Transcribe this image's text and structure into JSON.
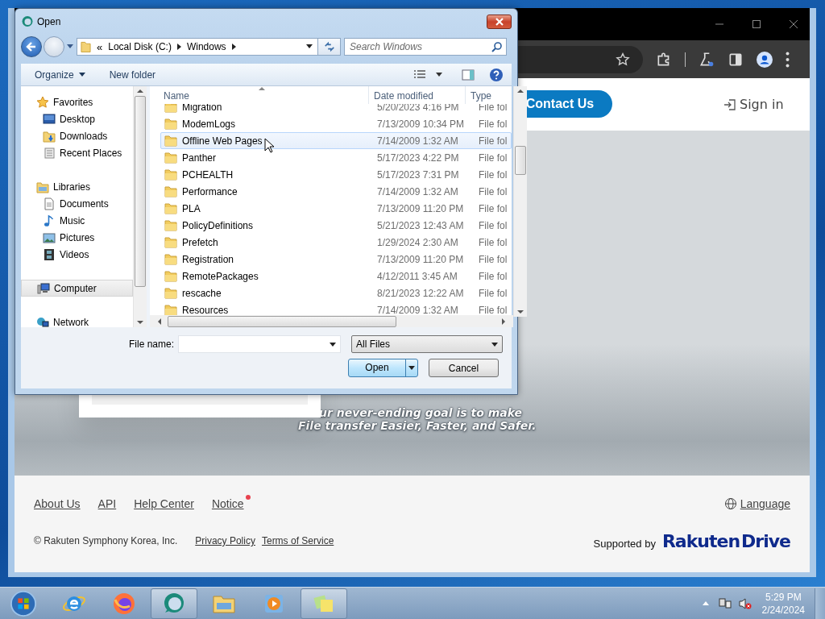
{
  "browser": {
    "header": {
      "contact_button": "Contact Us",
      "sign_in": "Sign in"
    },
    "hero": {
      "tagline": [
        "ur never-ending goal is to make",
        "File transfer Easier, Faster, and Safer."
      ]
    },
    "footer": {
      "links": [
        {
          "label": "About Us",
          "badge": false
        },
        {
          "label": "API",
          "badge": false
        },
        {
          "label": "Help Center",
          "badge": false
        },
        {
          "label": "Notice",
          "badge": true
        }
      ],
      "language": "Language",
      "copyright": "© Rakuten Symphony Korea, Inc.",
      "legal_links": [
        "Privacy Policy",
        "Terms of Service"
      ],
      "supported_by": "Supported by",
      "brand": "Rakuten",
      "brand_product": "Drive"
    }
  },
  "dialog": {
    "title": "Open",
    "breadcrumb_overflow": "«",
    "breadcrumb": [
      "Local Disk (C:)",
      "Windows"
    ],
    "search": {
      "placeholder": "Search Windows"
    },
    "toolbar": {
      "organize": "Organize",
      "new_folder": "New folder"
    },
    "nav": [
      {
        "label": "Favorites",
        "kind": "favorites",
        "selected": false,
        "children": [
          {
            "label": "Desktop",
            "kind": "desktop",
            "selected": false
          },
          {
            "label": "Downloads",
            "kind": "downloads",
            "selected": false
          },
          {
            "label": "Recent Places",
            "kind": "recent",
            "selected": false
          }
        ]
      },
      {
        "label": "Libraries",
        "kind": "libraries",
        "selected": false,
        "children": [
          {
            "label": "Documents",
            "kind": "documents",
            "selected": false
          },
          {
            "label": "Music",
            "kind": "music",
            "selected": false
          },
          {
            "label": "Pictures",
            "kind": "pictures",
            "selected": false
          },
          {
            "label": "Videos",
            "kind": "videos",
            "selected": false
          }
        ]
      },
      {
        "label": "Computer",
        "kind": "computer",
        "selected": true
      },
      {
        "label": "Network",
        "kind": "network",
        "selected": false
      }
    ],
    "columns": [
      "Name",
      "Date modified",
      "Type"
    ],
    "rows": [
      {
        "name": "Migration",
        "date": "5/20/2023 4:16 PM",
        "type": "File fol",
        "hovered": false
      },
      {
        "name": "ModemLogs",
        "date": "7/13/2009 10:34 PM",
        "type": "File fol",
        "hovered": false
      },
      {
        "name": "Offline Web Pages",
        "date": "7/14/2009 1:32 AM",
        "type": "File fol",
        "hovered": true
      },
      {
        "name": "Panther",
        "date": "5/17/2023 4:22 PM",
        "type": "File fol",
        "hovered": false
      },
      {
        "name": "PCHEALTH",
        "date": "5/17/2023 7:31 PM",
        "type": "File fol",
        "hovered": false
      },
      {
        "name": "Performance",
        "date": "7/14/2009 1:32 AM",
        "type": "File fol",
        "hovered": false
      },
      {
        "name": "PLA",
        "date": "7/13/2009 11:20 PM",
        "type": "File fol",
        "hovered": false
      },
      {
        "name": "PolicyDefinitions",
        "date": "5/21/2023 12:43 AM",
        "type": "File fol",
        "hovered": false
      },
      {
        "name": "Prefetch",
        "date": "1/29/2024 2:30 AM",
        "type": "File fol",
        "hovered": false
      },
      {
        "name": "Registration",
        "date": "7/13/2009 11:20 PM",
        "type": "File fol",
        "hovered": false
      },
      {
        "name": "RemotePackages",
        "date": "4/12/2011 3:45 AM",
        "type": "File fol",
        "hovered": false
      },
      {
        "name": "rescache",
        "date": "8/21/2023 12:22 AM",
        "type": "File fol",
        "hovered": false
      },
      {
        "name": "Resources",
        "date": "7/14/2009 1:32 AM",
        "type": "File fol",
        "hovered": false
      }
    ],
    "file_name_label": "File name:",
    "filter": "All Files",
    "buttons": {
      "open": "Open",
      "cancel": "Cancel"
    }
  },
  "taskbar": {
    "items": [
      {
        "kind": "ie",
        "selected": false
      },
      {
        "kind": "firefox",
        "selected": false
      },
      {
        "kind": "app",
        "selected": true
      },
      {
        "kind": "explorer",
        "selected": false
      },
      {
        "kind": "media",
        "selected": false
      },
      {
        "kind": "notes",
        "selected": true
      }
    ],
    "time": "5:29 PM",
    "date": "2/24/2024"
  }
}
